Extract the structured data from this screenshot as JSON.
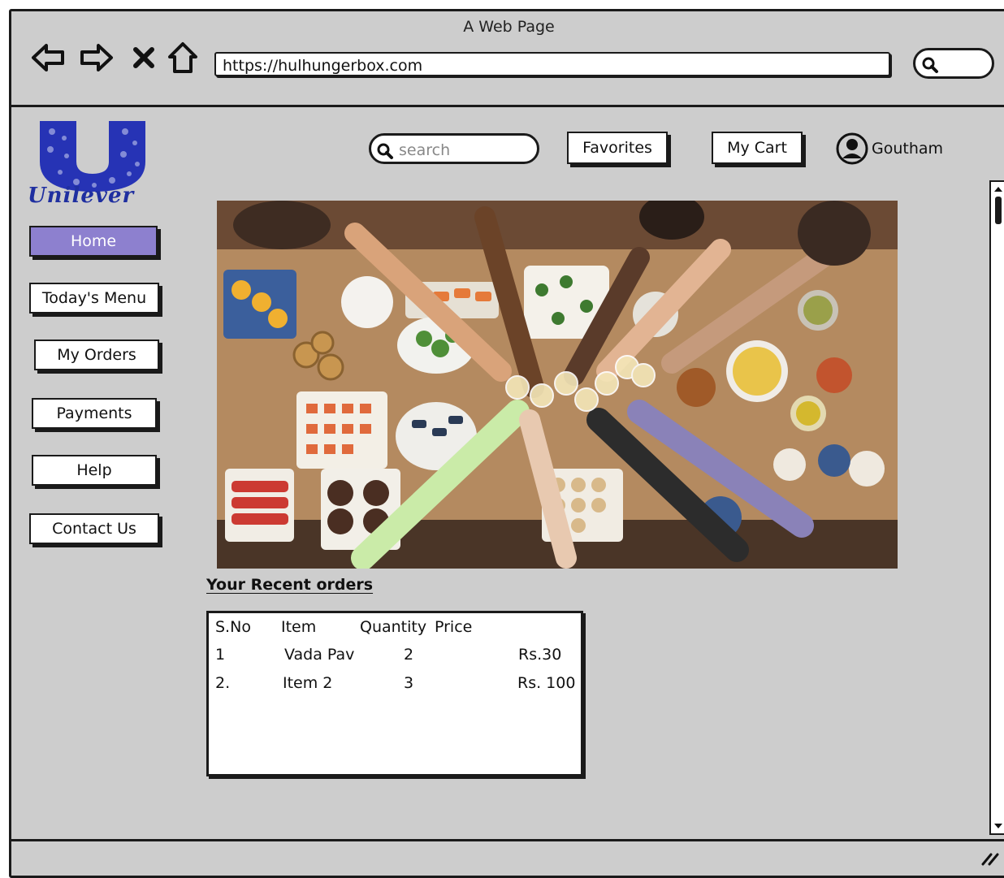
{
  "window": {
    "title": "A Web Page"
  },
  "browser": {
    "url": "https://hulhungerbox.com",
    "nav": [
      {
        "name": "back-button",
        "icon": "back-arrow-icon"
      },
      {
        "name": "forward-button",
        "icon": "forward-arrow-icon"
      },
      {
        "name": "stop-button",
        "icon": "close-icon"
      },
      {
        "name": "home-button",
        "icon": "home-icon"
      }
    ],
    "search_icon": "search-icon"
  },
  "brand": {
    "logo_text": "Unilever",
    "color": "#1f2fa0"
  },
  "header": {
    "search_placeholder": "search",
    "favorites_label": "Favorites",
    "cart_label": "My Cart",
    "user_name": "Goutham"
  },
  "sidebar": {
    "items": [
      {
        "label": "Home",
        "active": true
      },
      {
        "label": "Today's Menu",
        "active": false
      },
      {
        "label": "My Orders",
        "active": false
      },
      {
        "label": "Payments",
        "active": false
      },
      {
        "label": "Help",
        "active": false
      },
      {
        "label": "Contact Us",
        "active": false
      }
    ],
    "active_color": "#8d80cf"
  },
  "hero": {
    "subject": "photo-food-table-toast"
  },
  "orders": {
    "title": "Your Recent orders",
    "columns": [
      "S.No",
      "Item",
      "Quantity",
      "Price"
    ],
    "rows": [
      {
        "sno": "1",
        "item": "Vada Pav",
        "qty": "2",
        "price": "Rs.30"
      },
      {
        "sno": "2.",
        "item": "Item 2",
        "qty": "3",
        "price": "Rs. 100"
      }
    ]
  }
}
